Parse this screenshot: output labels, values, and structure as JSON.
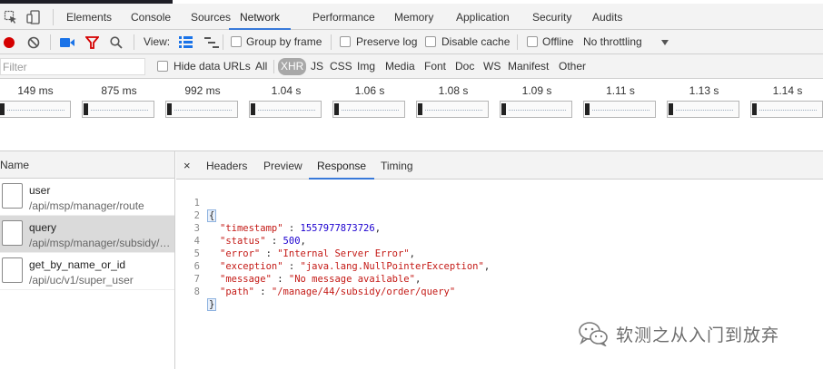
{
  "tabs": [
    "Elements",
    "Console",
    "Sources",
    "Network",
    "Performance",
    "Memory",
    "Application",
    "Security",
    "Audits"
  ],
  "active_tab": "Network",
  "toolbar": {
    "view_label": "View:",
    "group_by_frame": "Group by frame",
    "preserve_log": "Preserve log",
    "disable_cache": "Disable cache",
    "offline": "Offline",
    "throttling": "No throttling"
  },
  "filter": {
    "placeholder": "Filter",
    "hide_data_urls": "Hide data URLs",
    "types": [
      "All",
      "XHR",
      "JS",
      "CSS",
      "Img",
      "Media",
      "Font",
      "Doc",
      "WS",
      "Manifest",
      "Other"
    ],
    "selected_type": "XHR"
  },
  "overview": {
    "times": [
      "149 ms",
      "875 ms",
      "992 ms",
      "1.04 s",
      "1.06 s",
      "1.08 s",
      "1.09 s",
      "1.11 s",
      "1.13 s",
      "1.14 s"
    ]
  },
  "requests": {
    "header": "Name",
    "items": [
      {
        "name": "user",
        "path": "/api/msp/manager/route"
      },
      {
        "name": "query",
        "path": "/api/msp/manager/subsidy/order/query"
      },
      {
        "name": "get_by_name_or_id",
        "path": "/api/uc/v1/super_user"
      }
    ],
    "selected_index": 1
  },
  "details": {
    "close": "×",
    "tabs": [
      "Headers",
      "Preview",
      "Response",
      "Timing"
    ],
    "active_tab": "Response",
    "response_lines": [
      {
        "num": "1",
        "text": "{"
      },
      {
        "num": "2",
        "key": "\"timestamp\"",
        "sep": " : ",
        "value": "1557977873726",
        "type": "number",
        "tail": ","
      },
      {
        "num": "3",
        "key": "\"status\"",
        "sep": " : ",
        "value": "500",
        "type": "number",
        "tail": ","
      },
      {
        "num": "4",
        "key": "\"error\"",
        "sep": " : ",
        "value": "\"Internal Server Error\"",
        "type": "string",
        "tail": ","
      },
      {
        "num": "5",
        "key": "\"exception\"",
        "sep": " : ",
        "value": "\"java.lang.NullPointerException\"",
        "type": "string",
        "tail": ","
      },
      {
        "num": "6",
        "key": "\"message\"",
        "sep": " : ",
        "value": "\"No message available\"",
        "type": "string",
        "tail": ","
      },
      {
        "num": "7",
        "key": "\"path\"",
        "sep": " : ",
        "value": "\"/manage/44/subsidy/order/query\"",
        "type": "string",
        "tail": ""
      },
      {
        "num": "8",
        "text": "}"
      }
    ]
  },
  "watermark": "软测之从入门到放弃",
  "colors": {
    "accent": "#3879d9",
    "record": "#d50000",
    "filter_icon": "#d50000",
    "camera": "#1a73e8",
    "json_key": "#c41a16",
    "json_number": "#1c00cf"
  }
}
